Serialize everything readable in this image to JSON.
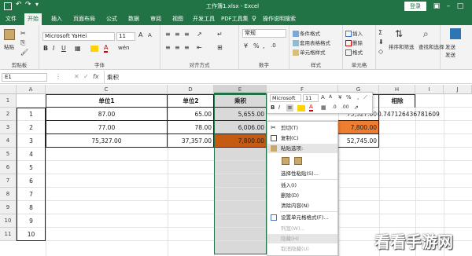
{
  "titlebar": {
    "doc_title": "工作簿1.xlsx - Excel",
    "login": "登录"
  },
  "tabs": [
    "文件",
    "开始",
    "插入",
    "页面布局",
    "公式",
    "数据",
    "审阅",
    "视图",
    "开发工具",
    "PDF工具集",
    "操作说明搜索"
  ],
  "ribbon": {
    "paste": "粘贴",
    "clipboard": "剪贴板",
    "font_name": "Microsoft YaHei",
    "font_size": "11",
    "font_group": "字体",
    "align_group": "对齐方式",
    "number_format": "常规",
    "number_group": "数字",
    "cond_format": "条件格式",
    "table_format": "套用表格格式",
    "cell_style": "单元格样式",
    "style_group": "样式",
    "insert": "插入",
    "delete": "删除",
    "format": "格式",
    "cells_group": "单元格",
    "sort_filter": "排序和筛选",
    "find_select": "查找和选择",
    "send": "发送",
    "send2": "发送"
  },
  "formula_bar": {
    "name_box": "E1",
    "fx": "fx",
    "content": "乘积"
  },
  "columns": [
    "A",
    "B",
    "C",
    "D",
    "E",
    "F",
    "G",
    "H",
    "I",
    "J"
  ],
  "rows": [
    "1",
    "2",
    "3",
    "4",
    "5",
    "6",
    "7",
    "8",
    "9",
    "10",
    "11"
  ],
  "table": {
    "headers": [
      "单位1",
      "单位2",
      "乘积"
    ],
    "rows": [
      {
        "a": "1",
        "c": "87.00",
        "d": "65.00",
        "e": "5,655.00"
      },
      {
        "a": "2",
        "c": "77.00",
        "d": "78.00",
        "e": "6,006.00"
      },
      {
        "a": "3",
        "c": "75,327.00",
        "d": "37,357.00",
        "e": "7,800.00"
      }
    ],
    "g_header": "相除",
    "g_values": [
      "7,800.00",
      "52,745.00"
    ],
    "h_value": "0.747126436781609",
    "f_value": "75,327.00"
  },
  "mini_toolbar": {
    "font": "Microsoft",
    "size": "11",
    "percent": "%"
  },
  "context_menu": [
    {
      "label": "剪切(T)",
      "icon": "scissors-icon",
      "disabled": false
    },
    {
      "label": "复制(C)",
      "icon": "copy-icon",
      "disabled": false
    },
    {
      "label": "粘贴选项:",
      "icon": "clipboard-icon",
      "disabled": false
    },
    {
      "label": "",
      "icon": "paste-options-icon",
      "disabled": false
    },
    {
      "label": "选择性粘贴(S)...",
      "icon": "",
      "disabled": false
    },
    {
      "label": "插入(I)",
      "icon": "",
      "disabled": false
    },
    {
      "label": "删除(D)",
      "icon": "",
      "disabled": false
    },
    {
      "label": "清除内容(N)",
      "icon": "",
      "disabled": false
    },
    {
      "label": "设置单元格格式(F)...",
      "icon": "format-cells-icon",
      "disabled": false
    },
    {
      "label": "列宽(W)...",
      "icon": "",
      "disabled": true
    },
    {
      "label": "隐藏(H)",
      "icon": "",
      "disabled": true
    },
    {
      "label": "取消隐藏(U)",
      "icon": "",
      "disabled": true
    }
  ],
  "watermark": "看看手游网",
  "colors": {
    "excel_green": "#217346",
    "orange": "#c55a11",
    "selected_gray": "#d9d9d9"
  }
}
